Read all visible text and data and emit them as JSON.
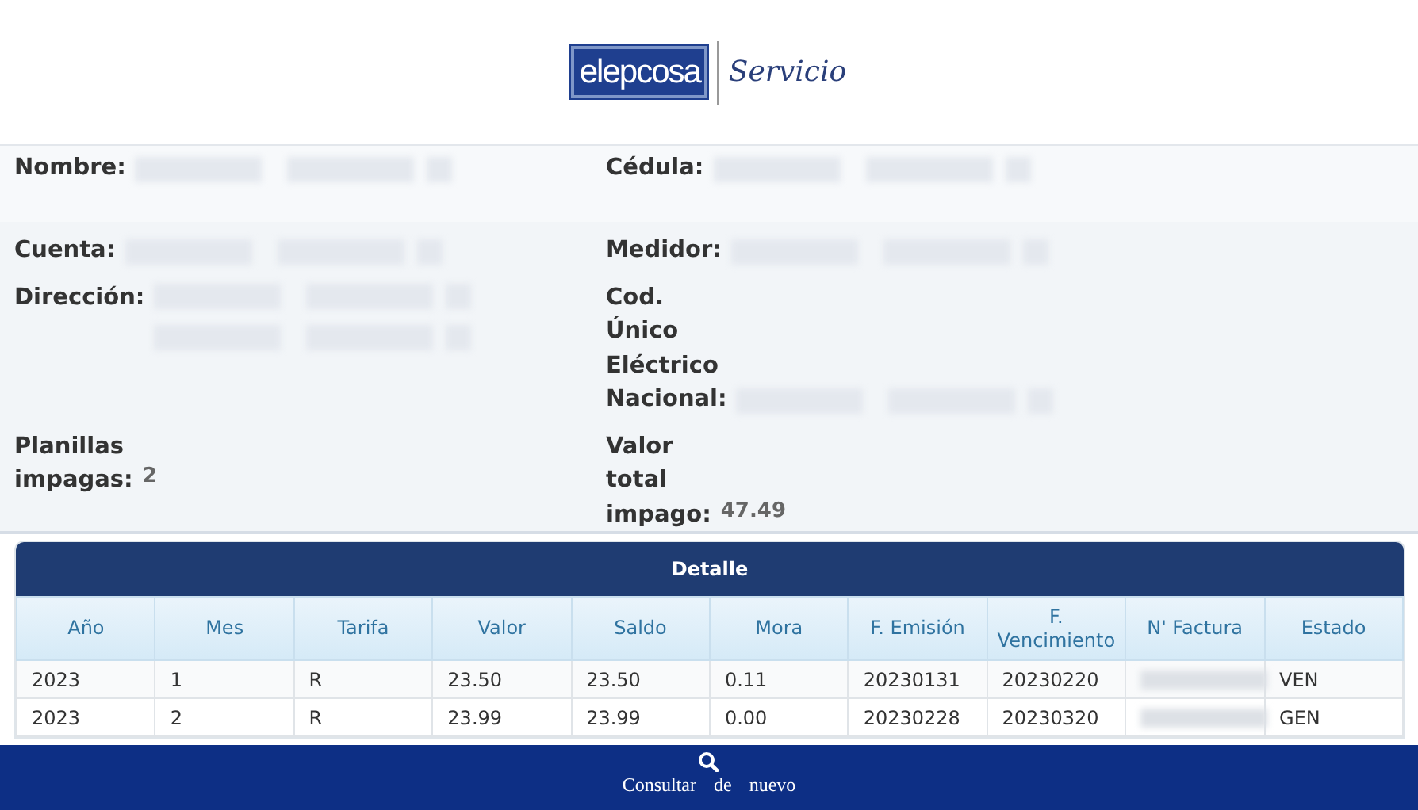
{
  "logo": {
    "brand": "elepcosa",
    "tagline": "Servicio"
  },
  "info_rows": [
    {
      "highlight": true,
      "fields": [
        {
          "label": "Nombre:",
          "values": [
            {
              "redacted": true
            }
          ]
        },
        {
          "label": "Cédula:",
          "values": [
            {
              "redacted": true
            }
          ]
        }
      ]
    },
    {
      "highlight": false,
      "fields": [
        {
          "label": "Cuenta:",
          "values": [
            {
              "redacted": true
            }
          ]
        },
        {
          "label": "Medidor:",
          "values": [
            {
              "redacted": true
            }
          ]
        }
      ]
    },
    {
      "highlight": false,
      "fields": [
        {
          "label": "Dirección:",
          "values": [
            {
              "redacted": true
            },
            {
              "redacted": true
            }
          ]
        },
        {
          "label": "Cod. Único Eléctrico Nacional:",
          "values": [
            {
              "redacted": true
            }
          ]
        }
      ]
    },
    {
      "highlight": false,
      "fields": [
        {
          "label": "Planillas impagas:",
          "values": [
            {
              "text": "2"
            }
          ]
        },
        {
          "label": "Valor total impago:",
          "values": [
            {
              "text": "47.49"
            }
          ]
        }
      ]
    }
  ],
  "detail": {
    "title": "Detalle",
    "columns": [
      "Año",
      "Mes",
      "Tarifa",
      "Valor",
      "Saldo",
      "Mora",
      "F. Emisión",
      "F. Vencimiento",
      "N' Factura",
      "Estado"
    ],
    "rows": [
      {
        "cells": [
          {
            "text": "2023"
          },
          {
            "text": "1"
          },
          {
            "text": "R"
          },
          {
            "text": "23.50"
          },
          {
            "text": "23.50"
          },
          {
            "text": "0.11"
          },
          {
            "text": "20230131"
          },
          {
            "text": "20230220"
          },
          {
            "redacted": true
          },
          {
            "text": "VEN"
          }
        ]
      },
      {
        "cells": [
          {
            "text": "2023"
          },
          {
            "text": "2"
          },
          {
            "text": "R"
          },
          {
            "text": "23.99"
          },
          {
            "text": "23.99"
          },
          {
            "text": "0.00"
          },
          {
            "text": "20230228"
          },
          {
            "text": "20230320"
          },
          {
            "redacted": true
          },
          {
            "text": "GEN"
          }
        ]
      }
    ]
  },
  "footer": {
    "button": "Consultar de nuevo"
  }
}
